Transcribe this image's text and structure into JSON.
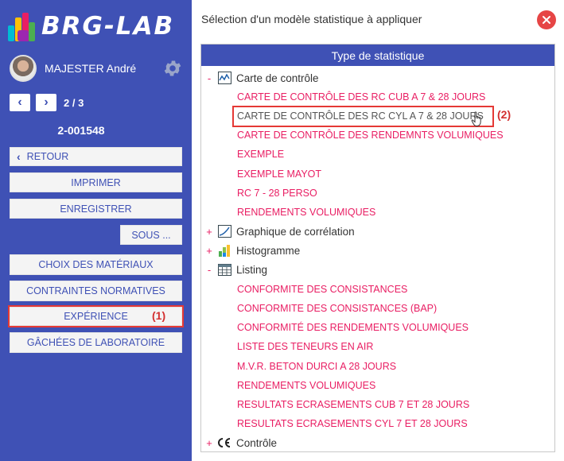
{
  "app": {
    "logo_text": "BRG-LAB"
  },
  "sidebar": {
    "user_name": "MAJESTER André",
    "pager_text": "2 / 3",
    "record_id": "2-001548",
    "back_label": "RETOUR",
    "print_label": "IMPRIMER",
    "save_label": "ENREGISTRER",
    "sub_label": "SOUS ...",
    "buttons": [
      "CHOIX DES MATÉRIAUX",
      "CONTRAINTES NORMATIVES",
      "EXPÉRIENCE",
      "GÂCHÉES DE LABORATOIRE"
    ],
    "experience_callout": "(1)"
  },
  "main": {
    "title": "Sélection d'un modèle statistique à appliquer",
    "panel_header": "Type de statistique",
    "selected_callout": "(2)",
    "tree": [
      {
        "toggle": "-",
        "label": "Carte de contrôle",
        "icon": "control-chart-icon",
        "children": [
          "CARTE DE CONTRÔLE DES RC CUB A 7 & 28 JOURS",
          "CARTE DE CONTRÔLE DES RC CYL A 7 & 28 JOURS",
          "CARTE DE CONTRÔLE DES RENDEMNTS VOLUMIQUES",
          "EXEMPLE",
          "EXEMPLE MAYOT",
          "RC 7 - 28 PERSO",
          "RENDEMENTS VOLUMIQUES"
        ]
      },
      {
        "toggle": "+",
        "label": "Graphique de corrélation",
        "icon": "correlation-chart-icon",
        "children": []
      },
      {
        "toggle": "+",
        "label": "Histogramme",
        "icon": "histogram-icon",
        "children": []
      },
      {
        "toggle": "-",
        "label": "Listing",
        "icon": "table-icon",
        "children": [
          "CONFORMITE DES CONSISTANCES",
          "CONFORMITE DES CONSISTANCES (BAP)",
          "CONFORMITÉ DES RENDEMENTS VOLUMIQUES",
          "LISTE DES TENEURS EN AIR",
          "M.V.R. BETON DURCI A 28 JOURS",
          "RENDEMENTS VOLUMIQUES",
          "RESULTATS ECRASEMENTS CUB 7 ET 28 JOURS",
          "RESULTATS ECRASEMENTS CYL 7 ET 28 JOURS"
        ]
      },
      {
        "toggle": "+",
        "label": "Contrôle",
        "icon": "ce-mark-icon",
        "children": []
      }
    ]
  },
  "colors": {
    "sidebar": "#3f51b5",
    "accent_pink": "#e91e63",
    "highlight_red": "#e53935",
    "close": "#e64545"
  }
}
